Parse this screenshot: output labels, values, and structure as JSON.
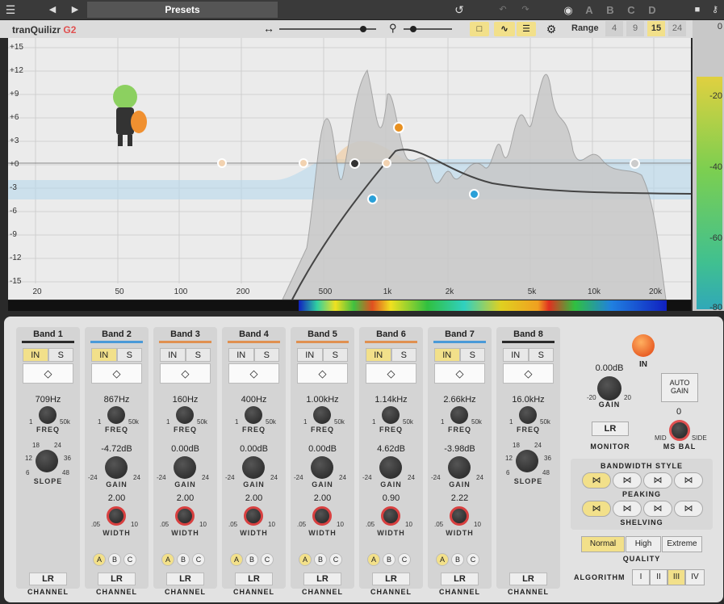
{
  "topbar": {
    "presets": "Presets",
    "ab": [
      "A",
      "B",
      "C",
      "D"
    ]
  },
  "toolbar": {
    "brand": "tranQuilizr",
    "brand_suffix": "G2",
    "range_label": "Range",
    "range_options": [
      "4",
      "9",
      "15",
      "24"
    ],
    "range_selected": "15"
  },
  "graph": {
    "y_ticks": [
      "+15",
      "+12",
      "+9",
      "+6",
      "+3",
      "+0",
      "-3",
      "-6",
      "-9",
      "-12",
      "-15"
    ],
    "x_ticks": [
      "20",
      "50",
      "100",
      "200",
      "500",
      "1k",
      "2k",
      "5k",
      "10k",
      "20k"
    ]
  },
  "meter": {
    "labels": [
      "0",
      "-20",
      "-40",
      "-60",
      "-80"
    ]
  },
  "bands": [
    {
      "title": "Band 1",
      "color": "#2a2a2a",
      "in": true,
      "s": "S",
      "in_label": "IN",
      "freq": "709Hz",
      "gain": "",
      "width": "",
      "slope": true,
      "gain_visible": false,
      "channel": "LR"
    },
    {
      "title": "Band 2",
      "color": "#4a9ad8",
      "in": true,
      "s": "S",
      "in_label": "IN",
      "freq": "867Hz",
      "gain": "-4.72dB",
      "width": "2.00",
      "slope": false,
      "channel": "LR"
    },
    {
      "title": "Band 3",
      "color": "#e09050",
      "in": false,
      "s": "S",
      "in_label": "IN",
      "freq": "160Hz",
      "gain": "0.00dB",
      "width": "2.00",
      "slope": false,
      "channel": "LR"
    },
    {
      "title": "Band 4",
      "color": "#e09050",
      "in": false,
      "s": "S",
      "in_label": "IN",
      "freq": "400Hz",
      "gain": "0.00dB",
      "width": "2.00",
      "slope": false,
      "channel": "LR"
    },
    {
      "title": "Band 5",
      "color": "#e09050",
      "in": false,
      "s": "S",
      "in_label": "IN",
      "freq": "1.00kHz",
      "gain": "0.00dB",
      "width": "2.00",
      "slope": false,
      "channel": "LR"
    },
    {
      "title": "Band 6",
      "color": "#e09050",
      "in": true,
      "s": "S",
      "in_label": "IN",
      "freq": "1.14kHz",
      "gain": "4.62dB",
      "width": "0.90",
      "slope": false,
      "channel": "LR"
    },
    {
      "title": "Band 7",
      "color": "#4a9ad8",
      "in": true,
      "s": "S",
      "in_label": "IN",
      "freq": "2.66kHz",
      "gain": "-3.98dB",
      "width": "2.22",
      "slope": false,
      "channel": "LR"
    },
    {
      "title": "Band 8",
      "color": "#2a2a2a",
      "in": false,
      "s": "S",
      "in_label": "IN",
      "freq": "16.0kHz",
      "gain": "",
      "width": "",
      "slope": true,
      "channel": "LR"
    }
  ],
  "labels": {
    "freq": "FREQ",
    "gain": "GAIN",
    "width": "WIDTH",
    "slope": "SLOPE",
    "channel": "CHANNEL",
    "freq_min": "1",
    "freq_max": "50k",
    "gain_min": "-24",
    "gain_max": "24",
    "width_min": ".05",
    "width_max": "10",
    "slope_vals": [
      "18",
      "24",
      "12",
      "36",
      "6",
      "48"
    ],
    "abc": [
      "A",
      "B",
      "C"
    ]
  },
  "right": {
    "in_label": "IN",
    "gain_value": "0.00dB",
    "gain_label": "GAIN",
    "gain_min": "-20",
    "gain_max": "20",
    "auto_gain": "AUTO GAIN",
    "monitor_value": "LR",
    "monitor_label": "MONITOR",
    "msbal_value": "0",
    "msbal_label": "MS BAL",
    "msbal_min": "MID",
    "msbal_max": "SIDE",
    "bw_style": "BANDWIDTH STYLE",
    "peaking": "PEAKING",
    "shelving": "SHELVING",
    "quality_options": [
      "Normal",
      "High",
      "Extreme"
    ],
    "quality_label": "QUALITY",
    "algorithm_label": "ALGORITHM",
    "algorithm_options": [
      "I",
      "II",
      "III",
      "IV"
    ],
    "algorithm_selected": "III"
  }
}
